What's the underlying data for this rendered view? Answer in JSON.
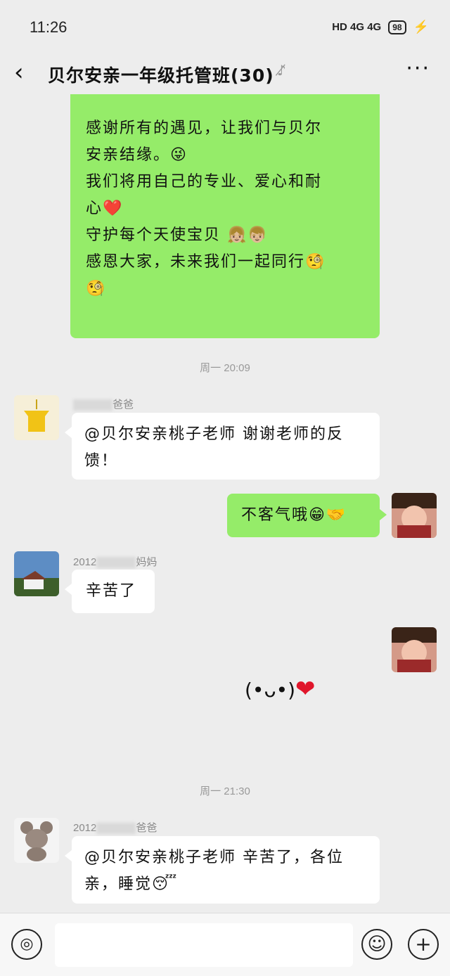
{
  "status": {
    "time": "11:26",
    "signal": "HD 4G 4G",
    "battery": "98"
  },
  "header": {
    "back": "‹",
    "title": "贝尔安亲一年级托管班(30)",
    "more": "···"
  },
  "messages": {
    "m1": {
      "line1": "感谢所有的遇见，让我们与贝尔",
      "line2": "安亲结缘。😜",
      "line3": "我们将用自己的专业、爱心和耐",
      "line4": "心❤️",
      "line5": "守护每个天使宝贝 👧🏼👦🏼",
      "line6": "感恩大家，未来我们一起同行🧐",
      "line7": "🧐"
    },
    "ts1": "周一 20:09",
    "m2": {
      "sender": "爸爸",
      "line1": "@贝尔安亲桃子老师 谢谢老师的反",
      "line2": "馈！"
    },
    "m3": {
      "text": "不客气哦😁🤝"
    },
    "m4": {
      "sender": "2012",
      "sender_suffix": "妈妈",
      "text": "辛苦了"
    },
    "m5": {
      "sticker": "(•ᴗ•)",
      "heart": "❤"
    },
    "ts2": "周一 21:30",
    "m6": {
      "sender": "2012",
      "sender_suffix": "爸爸",
      "line1": "@贝尔安亲桃子老师 辛苦了，各位",
      "line2": "亲，睡觉😴"
    }
  },
  "input": {
    "voice": "◎",
    "emoji": "☺",
    "plus": "+"
  }
}
